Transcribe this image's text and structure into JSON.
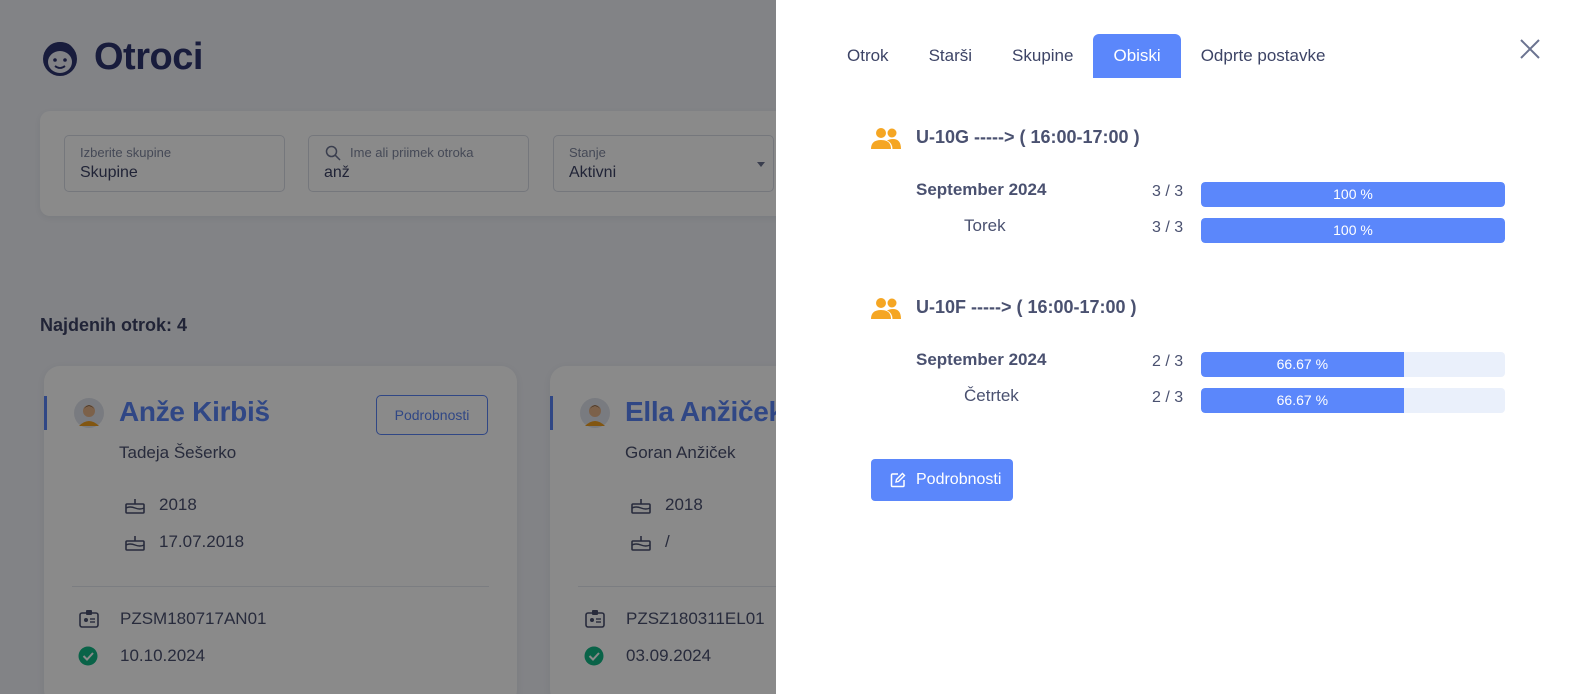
{
  "background": {
    "app_title": "Otroci",
    "filters": {
      "groups": {
        "label": "Izberite skupine",
        "value": "Skupine"
      },
      "search": {
        "label": "Ime ali priimek otroka",
        "value": "anž"
      },
      "state": {
        "label": "Stanje",
        "value": "Aktivni"
      }
    },
    "found_count": "Najdenih otrok: 4",
    "cards": [
      {
        "name": "Anže Kirbiš",
        "parent": "Tadeja Šešerko",
        "details_label": "Podrobnosti",
        "year": "2018",
        "birth_date": "17.07.2018",
        "code": "PZSM180717AN01",
        "check_date": "10.10.2024"
      },
      {
        "name": "Ella Anžiček",
        "parent": "Goran Anžiček",
        "year": "2018",
        "birth_date": "/",
        "code": "PZSZ180311EL01",
        "check_date": "03.09.2024"
      }
    ]
  },
  "drawer": {
    "tabs": [
      {
        "label": "Otrok",
        "active": false
      },
      {
        "label": "Starši",
        "active": false
      },
      {
        "label": "Skupine",
        "active": false
      },
      {
        "label": "Obiski",
        "active": true
      },
      {
        "label": "Odprte postavke",
        "active": false
      }
    ],
    "groups": [
      {
        "title": "U-10G -----> ( 16:00-17:00 )",
        "rows": [
          {
            "label": "September 2024",
            "count": "3 / 3",
            "percent": 100,
            "percent_label": "100 %"
          },
          {
            "label": "Torek",
            "count": "3 / 3",
            "percent": 100,
            "percent_label": "100 %"
          }
        ]
      },
      {
        "title": "U-10F -----> ( 16:00-17:00 )",
        "rows": [
          {
            "label": "September 2024",
            "count": "2 / 3",
            "percent": 66.67,
            "percent_label": "66.67 %"
          },
          {
            "label": "Četrtek",
            "count": "2 / 3",
            "percent": 66.67,
            "percent_label": "66.67 %"
          }
        ]
      }
    ],
    "action_label": "Podrobnosti"
  },
  "colors": {
    "accent": "#5b87fb",
    "group_icon": "#f5a623",
    "check": "#12b886"
  },
  "icons": [
    "child-face-icon",
    "search-icon",
    "caret-down-icon",
    "avatar-icon",
    "cake-icon",
    "id-card-icon",
    "check-circle-icon",
    "group-users-icon",
    "edit-icon",
    "close-icon"
  ]
}
